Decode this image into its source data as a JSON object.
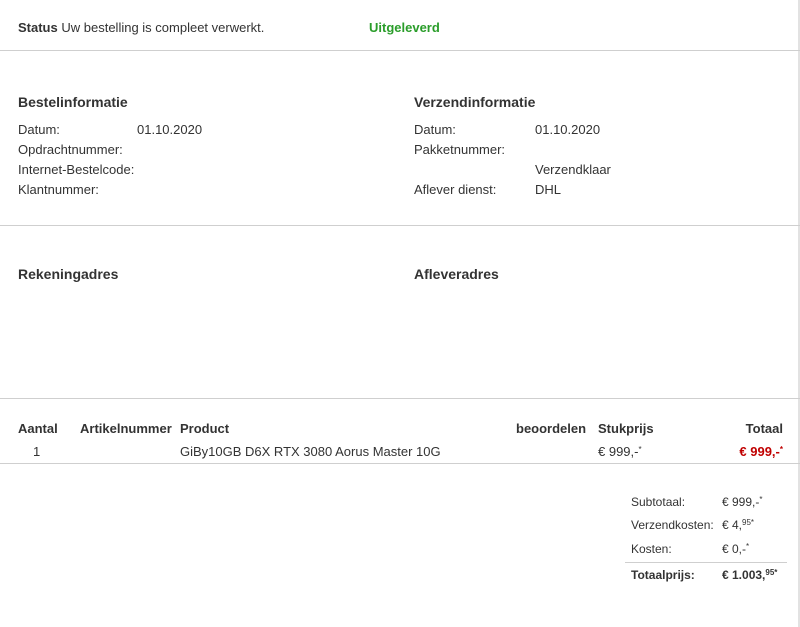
{
  "status": {
    "label": "Status",
    "text": "Uw bestelling is compleet verwerkt.",
    "value": "Uitgeleverd",
    "value_color": "#2a9d2a"
  },
  "order_info": {
    "title": "Bestelinformatie",
    "date_label": "Datum:",
    "date_value": "01.10.2020",
    "order_number_label": "Opdrachtnummer:",
    "internet_code_label": "Internet-Bestelcode:",
    "customer_number_label": "Klantnummer:"
  },
  "shipping_info": {
    "title": "Verzendinformatie",
    "date_label": "Datum:",
    "date_value": "01.10.2020",
    "package_number_label": "Pakketnummer:",
    "status_value": "Verzendklaar",
    "carrier_label": "Aflever dienst:",
    "carrier_value": "DHL"
  },
  "addresses": {
    "billing_title": "Rekeningadres",
    "delivery_title": "Afleveradres"
  },
  "items_table": {
    "headers": {
      "quantity": "Aantal",
      "article_number": "Artikelnummer",
      "product": "Product",
      "review": "beoordelen",
      "unit_price": "Stukprijs",
      "total": "Totaal"
    },
    "rows": [
      {
        "quantity": "1",
        "article_number": "",
        "product": "GiBy10GB D6X RTX 3080 Aorus Master 10G",
        "unit_price": "€ 999,-",
        "unit_price_mark": "*",
        "total": "€ 999,-",
        "total_mark": "*"
      }
    ]
  },
  "summary": {
    "subtotal_label": "Subtotaal:",
    "subtotal_value": "€ 999,-",
    "subtotal_mark": "*",
    "shipping_label": "Verzendkosten:",
    "shipping_value": "€ 4,",
    "shipping_sup": "95*",
    "costs_label": "Kosten:",
    "costs_value": "€ 0,-",
    "costs_mark": "*",
    "total_label": "Totaalprijs:",
    "total_value": "€ 1.003,",
    "total_sup": "95*"
  },
  "colors": {
    "accent_green": "#2a9d2a",
    "price_red": "#c00000",
    "divider": "#cfcfcf"
  }
}
